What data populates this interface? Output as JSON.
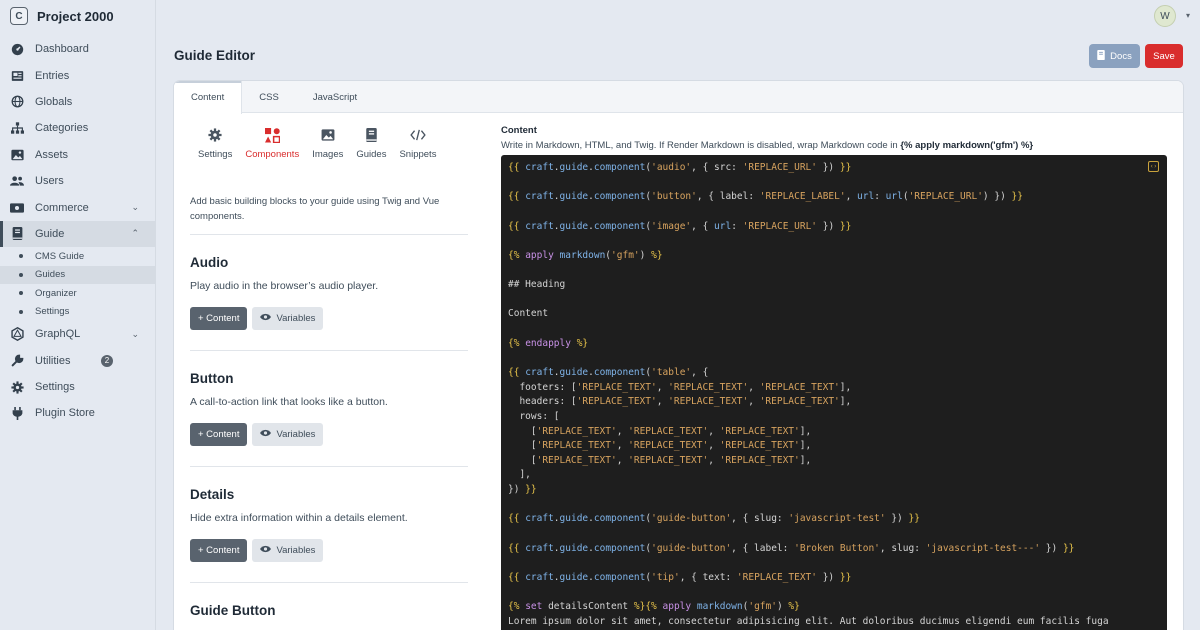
{
  "brand": {
    "logo_letter": "C",
    "name": "Project 2000"
  },
  "user": {
    "initial": "W"
  },
  "sidebar": {
    "items": [
      {
        "label": "Dashboard",
        "icon": "speedometer-icon"
      },
      {
        "label": "Entries",
        "icon": "newspaper-icon"
      },
      {
        "label": "Globals",
        "icon": "globe-icon"
      },
      {
        "label": "Categories",
        "icon": "sitemap-icon"
      },
      {
        "label": "Assets",
        "icon": "image-icon"
      },
      {
        "label": "Users",
        "icon": "users-icon"
      },
      {
        "label": "Commerce",
        "icon": "money-icon"
      },
      {
        "label": "Guide",
        "icon": "book-icon"
      },
      {
        "label": "GraphQL",
        "icon": "graphql-icon"
      },
      {
        "label": "Utilities",
        "icon": "wrench-icon",
        "badge": "2"
      },
      {
        "label": "Settings",
        "icon": "gear-icon"
      },
      {
        "label": "Plugin Store",
        "icon": "plug-icon"
      }
    ],
    "guide_sub": [
      "CMS Guide",
      "Guides",
      "Organizer",
      "Settings"
    ]
  },
  "header": {
    "title": "Guide Editor",
    "docs_label": "Docs",
    "save_label": "Save"
  },
  "tabs": [
    "Content",
    "CSS",
    "JavaScript"
  ],
  "toolbar": [
    {
      "label": "Settings",
      "icon": "gear-icon"
    },
    {
      "label": "Components",
      "icon": "puzzle-icon"
    },
    {
      "label": "Images",
      "icon": "image-icon"
    },
    {
      "label": "Guides",
      "icon": "book-icon"
    },
    {
      "label": "Snippets",
      "icon": "code-icon"
    }
  ],
  "intro": "Add basic building blocks to your guide using Twig and Vue components.",
  "components": [
    {
      "title": "Audio",
      "desc": "Play audio in the browser’s audio player."
    },
    {
      "title": "Button",
      "desc": "A call-to-action link that looks like a button."
    },
    {
      "title": "Details",
      "desc": "Hide extra information within a details element."
    },
    {
      "title": "Guide Button",
      "desc": ""
    }
  ],
  "buttons": {
    "content": "+ Content",
    "variables": "Variables"
  },
  "editor": {
    "title": "Content",
    "hint_prefix": "Write in Markdown, HTML, and Twig. If Render Markdown is disabled, wrap Markdown code in ",
    "hint_code": "{% apply markdown('gfm') %}",
    "lines": [
      "{{ craft.guide.component('audio', { src: 'REPLACE_URL' }) }}",
      "",
      "{{ craft.guide.component('button', { label: 'REPLACE_LABEL', url: url('REPLACE_URL') }) }}",
      "",
      "{{ craft.guide.component('image', { url: 'REPLACE_URL' }) }}",
      "",
      "{% apply markdown('gfm') %}",
      "",
      "## Heading",
      "",
      "Content",
      "",
      "{% endapply %}",
      "",
      "{{ craft.guide.component('table', {",
      "  footers: ['REPLACE_TEXT', 'REPLACE_TEXT', 'REPLACE_TEXT'],",
      "  headers: ['REPLACE_TEXT', 'REPLACE_TEXT', 'REPLACE_TEXT'],",
      "  rows: [",
      "    ['REPLACE_TEXT', 'REPLACE_TEXT', 'REPLACE_TEXT'],",
      "    ['REPLACE_TEXT', 'REPLACE_TEXT', 'REPLACE_TEXT'],",
      "    ['REPLACE_TEXT', 'REPLACE_TEXT', 'REPLACE_TEXT'],",
      "  ],",
      "}) }}",
      "",
      "{{ craft.guide.component('guide-button', { slug: 'javascript-test' }) }}",
      "",
      "{{ craft.guide.component('guide-button', { label: 'Broken Button', slug: 'javascript-test---' }) }}",
      "",
      "{{ craft.guide.component('tip', { text: 'REPLACE_TEXT' }) }}",
      "",
      "{% set detailsContent %}{% apply markdown('gfm') %}",
      "Lorem ipsum dolor sit amet, consectetur adipisicing elit. Aut doloribus ducimus eligendi eum facilis fuga"
    ]
  },
  "colors": {
    "save": "#d92d2d",
    "docs": "#8aa1bf",
    "active_tool": "#d92d2d",
    "editor_bg": "#1e1e1e"
  }
}
